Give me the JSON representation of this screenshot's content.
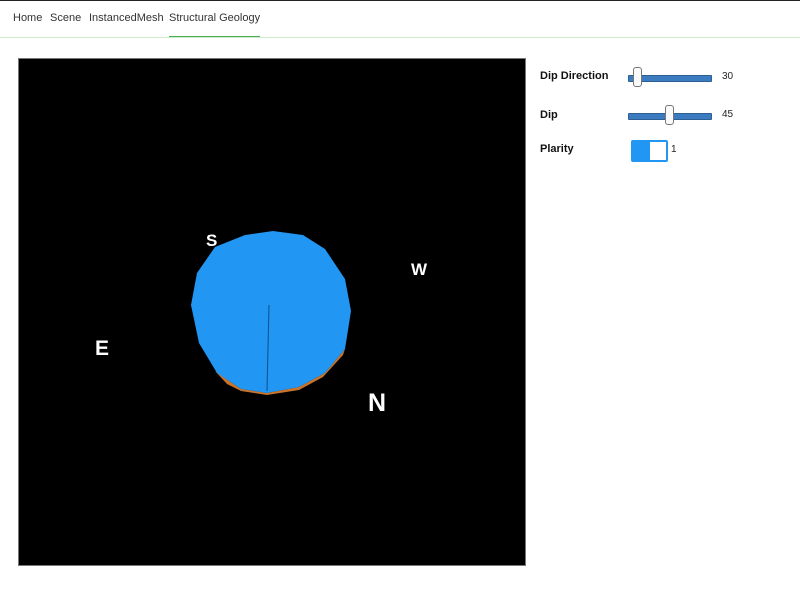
{
  "nav": {
    "items": [
      {
        "label": "Home",
        "active": false
      },
      {
        "label": "Scene",
        "active": false
      },
      {
        "label": "InstancedMesh",
        "active": false
      },
      {
        "label": "Structural Geology",
        "active": true
      }
    ]
  },
  "scene": {
    "background": "#000000",
    "disc_color": "#2196f3",
    "disc_edge_color": "#c8742c",
    "normal_line_color": "#0d4f8a",
    "compass": {
      "north": "N",
      "south": "S",
      "east": "E",
      "west": "W"
    }
  },
  "controls": {
    "dip_direction": {
      "label": "Dip Direction",
      "value": "30",
      "fraction": 0.12
    },
    "dip": {
      "label": "Dip",
      "value": "45",
      "fraction": 0.5
    },
    "plarity": {
      "label": "Plarity",
      "value": "1",
      "state": "on",
      "accent": "#2196f3"
    }
  }
}
